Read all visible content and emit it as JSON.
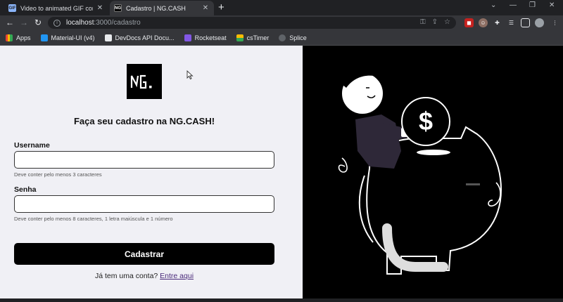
{
  "browser": {
    "tabs": [
      {
        "title": "Video to animated GIF converter",
        "favicon": "GIF"
      },
      {
        "title": "Cadastro | NG.CASH",
        "favicon": "NG"
      }
    ],
    "url_host": "localhost",
    "url_path": ":3000/cadastro",
    "bookmarks": [
      "Apps",
      "Material-UI (v4)",
      "DevDocs API Docu...",
      "Rocketseat",
      "csTimer",
      "Splice"
    ]
  },
  "form": {
    "logo_text": "NG.",
    "heading_prefix": "Faça seu cadastro na ",
    "heading_brand": "NG.CASH!",
    "username_label": "Username",
    "username_value": "",
    "username_hint": "Deve conter pelo menos 3 caracteres",
    "password_label": "Senha",
    "password_value": "",
    "password_hint": "Deve conter pelo menos 8 caracteres, 1 letra maiúscula e 1 número",
    "submit_label": "Cadastrar",
    "login_prompt": "Já tem uma conta? ",
    "login_link": "Entre aqui"
  },
  "colors": {
    "accent": "#000000",
    "link": "#4a2a7a",
    "left_bg": "#f0f0f5"
  }
}
